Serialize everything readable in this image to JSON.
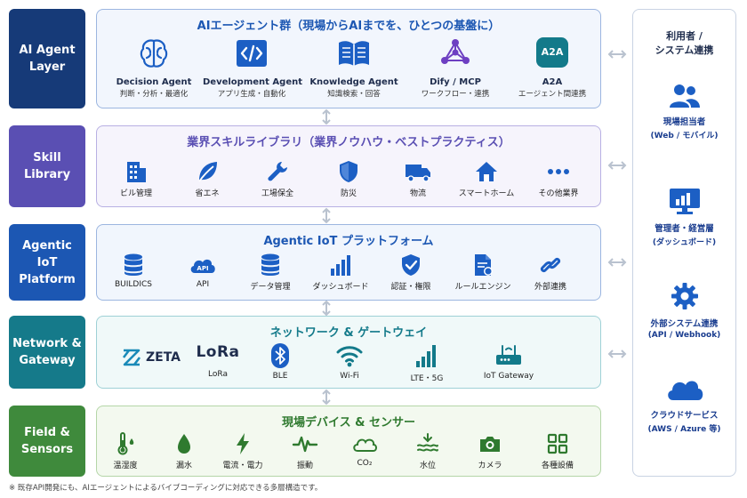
{
  "layers": {
    "ai": {
      "label": "AI Agent\nLayer",
      "title": "AIエージェント群（現場からAIまでを、ひとつの基盤に）",
      "items": [
        {
          "name": "Decision Agent",
          "sub": "判断・分析・最適化",
          "icon": "brain-icon"
        },
        {
          "name": "Development Agent",
          "sub": "アプリ生成・自動化",
          "icon": "code-icon"
        },
        {
          "name": "Knowledge Agent",
          "sub": "知識検索・回答",
          "icon": "book-icon"
        },
        {
          "name": "Dify / MCP",
          "sub": "ワークフロー・連携",
          "icon": "network-icon"
        },
        {
          "name": "A2A",
          "sub": "エージェント間連携",
          "icon": "a2a-icon",
          "badge": "A2A"
        }
      ]
    },
    "skill": {
      "label": "Skill\nLibrary",
      "title": "業界スキルライブラリ（業界ノウハウ・ベストプラクティス）",
      "items": [
        {
          "label": "ビル管理",
          "icon": "building-icon"
        },
        {
          "label": "省エネ",
          "icon": "leaf-icon"
        },
        {
          "label": "工場保全",
          "icon": "wrench-icon"
        },
        {
          "label": "防災",
          "icon": "shield-icon"
        },
        {
          "label": "物流",
          "icon": "truck-icon"
        },
        {
          "label": "スマートホーム",
          "icon": "home-icon"
        },
        {
          "label": "その他業界",
          "icon": "more-icon"
        }
      ]
    },
    "platform": {
      "label": "Agentic\nIoT\nPlatform",
      "title": "Agentic IoT プラットフォーム",
      "items": [
        {
          "label": "BUILDICS",
          "icon": "database-icon"
        },
        {
          "label": "API",
          "icon": "api-cloud-icon",
          "badge": "API"
        },
        {
          "label": "データ管理",
          "icon": "data-stack-icon"
        },
        {
          "label": "ダッシュボード",
          "icon": "bar-chart-icon"
        },
        {
          "label": "認証・権限",
          "icon": "shield-check-icon"
        },
        {
          "label": "ルールエンジン",
          "icon": "rule-doc-icon"
        },
        {
          "label": "外部連携",
          "icon": "link-icon"
        }
      ]
    },
    "network": {
      "label": "Network &\nGateway",
      "title": "ネットワーク & ゲートウェイ",
      "items": [
        {
          "label": "ZETA",
          "icon": "zeta-logo-icon"
        },
        {
          "label": "LoRa",
          "icon": "lora-logo-icon",
          "logo": "LoRa"
        },
        {
          "label": "BLE",
          "icon": "bluetooth-icon"
        },
        {
          "label": "Wi-Fi",
          "icon": "wifi-icon"
        },
        {
          "label": "LTE・5G",
          "icon": "signal-icon"
        },
        {
          "label": "IoT Gateway",
          "icon": "router-icon"
        }
      ]
    },
    "field": {
      "label": "Field &\nSensors",
      "title": "現場デバイス & センサー",
      "items": [
        {
          "label": "温湿度",
          "icon": "thermometer-icon"
        },
        {
          "label": "漏水",
          "icon": "water-drop-icon"
        },
        {
          "label": "電流・電力",
          "icon": "lightning-icon"
        },
        {
          "label": "振動",
          "icon": "pulse-icon"
        },
        {
          "label": "CO₂",
          "icon": "cloud-outline-icon"
        },
        {
          "label": "水位",
          "icon": "water-level-icon"
        },
        {
          "label": "カメラ",
          "icon": "camera-icon"
        },
        {
          "label": "各種設備",
          "icon": "grid-icon"
        }
      ]
    }
  },
  "side": {
    "title": "利用者 /\nシステム連携",
    "items": [
      {
        "title": "現場担当者",
        "sub": "(Web / モバイル)",
        "icon": "users-icon"
      },
      {
        "title": "管理者・経営層",
        "sub": "(ダッシュボード)",
        "icon": "monitor-chart-icon"
      },
      {
        "title": "外部システム連携",
        "sub": "(API / Webhook)",
        "icon": "gear-icon"
      },
      {
        "title": "クラウドサービス",
        "sub": "(AWS / Azure 等)",
        "icon": "cloud-icon"
      }
    ]
  },
  "footnote": "※ 既存API開発にも、AIエージェントによるバイブコーディングに対応できる多層構造です。",
  "colors": {
    "ai": "#163a78",
    "skill": "#5a4fb3",
    "platform": "#1c57b3",
    "network": "#157a8a",
    "field": "#3f8a3c",
    "icon_blue": "#1c5fc4",
    "icon_teal": "#137a8a",
    "icon_green": "#2f7a2f"
  }
}
